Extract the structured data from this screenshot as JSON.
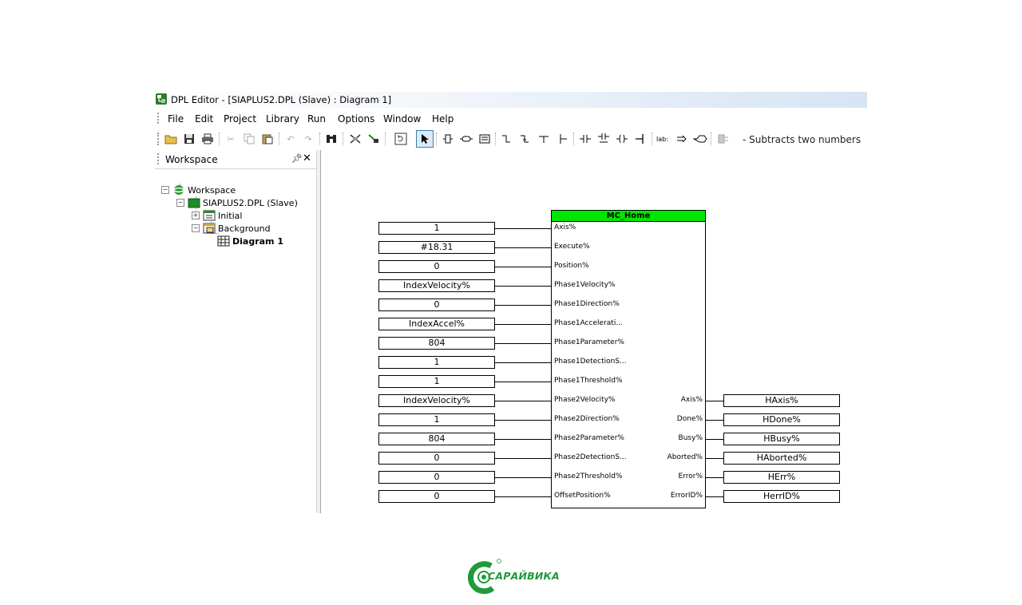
{
  "window": {
    "title": "DPL Editor - [SIAPLUS2.DPL (Slave) : Diagram 1]"
  },
  "menu": [
    "File",
    "Edit",
    "Project",
    "Library",
    "Run",
    "Options",
    "Window",
    "Help"
  ],
  "toolbar": {
    "status_hint": "-  Subtracts two numbers"
  },
  "workspace": {
    "title": "Workspace",
    "tree": {
      "root": "Workspace",
      "project": "SIAPLUS2.DPL (Slave)",
      "initial": "Initial",
      "background": "Background",
      "diagram": "Diagram 1"
    }
  },
  "block": {
    "title": "MC_Home",
    "inputs": [
      {
        "pin": "Axis%",
        "value": "1"
      },
      {
        "pin": "Execute%",
        "value": "#18.31"
      },
      {
        "pin": "Position%",
        "value": "0"
      },
      {
        "pin": "Phase1Velocity%",
        "value": "IndexVelocity%"
      },
      {
        "pin": "Phase1Direction%",
        "value": "0"
      },
      {
        "pin": "Phase1Accelerati...",
        "value": "IndexAccel%"
      },
      {
        "pin": "Phase1Parameter%",
        "value": "804"
      },
      {
        "pin": "Phase1DetectionS...",
        "value": "1"
      },
      {
        "pin": "Phase1Threshold%",
        "value": "1"
      },
      {
        "pin": "Phase2Velocity%",
        "value": "IndexVelocity%"
      },
      {
        "pin": "Phase2Direction%",
        "value": "1"
      },
      {
        "pin": "Phase2Parameter%",
        "value": "804"
      },
      {
        "pin": "Phase2DetectionS...",
        "value": "0"
      },
      {
        "pin": "Phase2Threshold%",
        "value": "0"
      },
      {
        "pin": "OffsetPosition%",
        "value": "0"
      }
    ],
    "outputs": [
      {
        "pin": "Axis%",
        "value": "HAxis%"
      },
      {
        "pin": "Done%",
        "value": "HDone%"
      },
      {
        "pin": "Busy%",
        "value": "HBusy%"
      },
      {
        "pin": "Aborted%",
        "value": "HAborted%"
      },
      {
        "pin": "Error%",
        "value": "HErr%"
      },
      {
        "pin": "ErrorID%",
        "value": "HerrID%"
      }
    ]
  },
  "logo": {
    "text": "САРАЙВИКА"
  },
  "colors": {
    "block_header": "#00e600",
    "logo_green": "#1f9a3a",
    "selection": "#3c7fb1"
  }
}
